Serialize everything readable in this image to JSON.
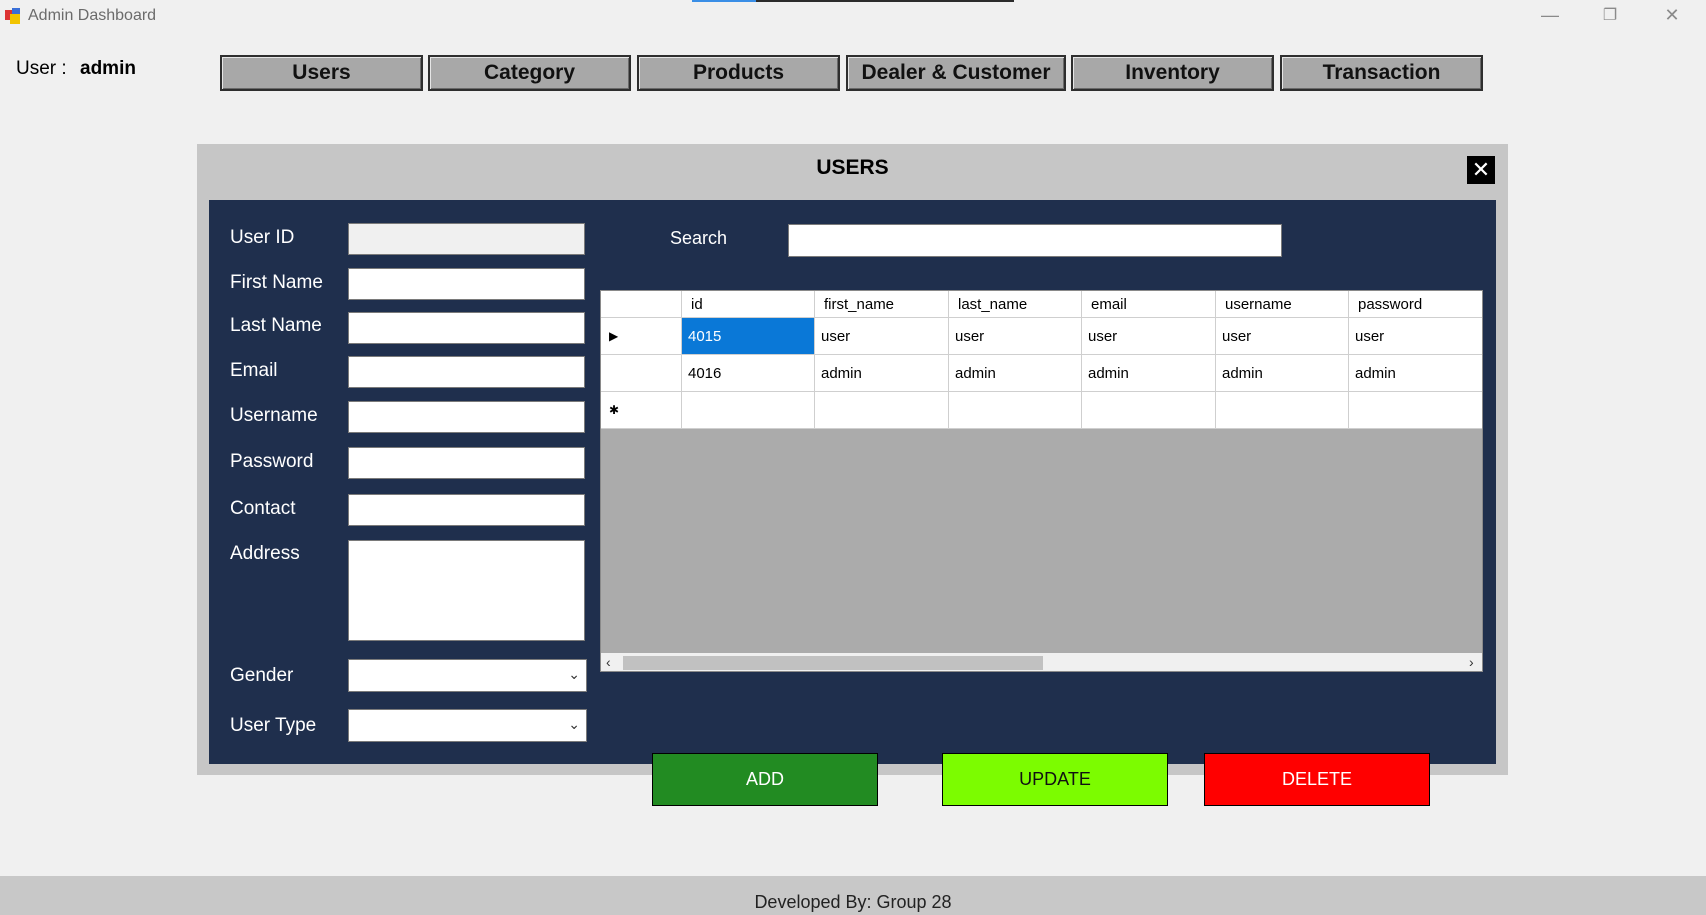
{
  "window": {
    "title": "Admin Dashboard",
    "progress": 0.2,
    "controls": {
      "minimize": "—",
      "restore": "❐",
      "close": "✕"
    }
  },
  "user": {
    "label": "User :",
    "name": "admin"
  },
  "nav": {
    "items": [
      {
        "label": "Users"
      },
      {
        "label": "Category"
      },
      {
        "label": "Products"
      },
      {
        "label": "Dealer & Customer"
      },
      {
        "label": "Inventory"
      },
      {
        "label": "Transaction"
      }
    ]
  },
  "panel": {
    "title": "USERS",
    "close": "✕",
    "form": {
      "user_id": "User ID",
      "first_name": "First Name",
      "last_name": "Last Name",
      "email": "Email",
      "username": "Username",
      "password": "Password",
      "contact": "Contact",
      "address": "Address",
      "gender": "Gender",
      "user_type": "User Type"
    },
    "search": {
      "label": "Search",
      "value": ""
    },
    "grid": {
      "columns": [
        "id",
        "first_name",
        "last_name",
        "email",
        "username",
        "password"
      ],
      "rows": [
        [
          "4015",
          "user",
          "user",
          "user",
          "user",
          "user"
        ],
        [
          "4016",
          "admin",
          "admin",
          "admin",
          "admin",
          "admin"
        ]
      ],
      "current_row_marker": "▶",
      "new_row_marker": "✱"
    },
    "buttons": {
      "add": "ADD",
      "update": "UPDATE",
      "delete": "DELETE"
    },
    "colors": {
      "add": "#228b22",
      "update": "#7cfc00",
      "delete": "#ff0000",
      "inner_bg": "#1f2f4d"
    }
  },
  "footer": {
    "text": "Developed By: Group 28"
  }
}
